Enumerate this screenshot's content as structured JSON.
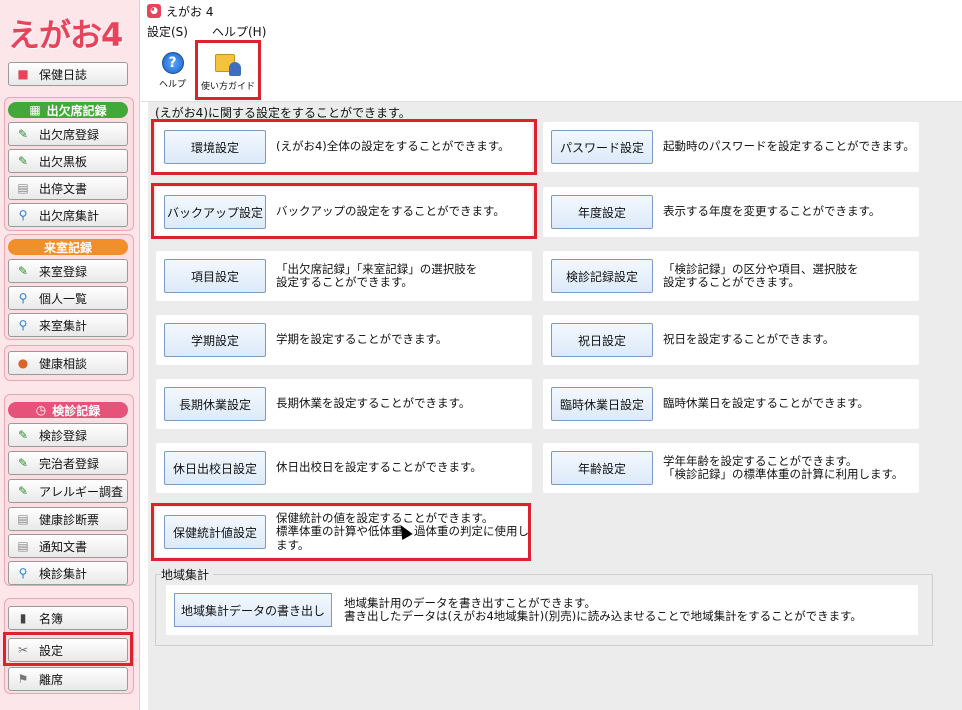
{
  "app": {
    "logo": "えがお4",
    "window_title": "えがお 4"
  },
  "menu": [
    "設定(S)",
    "ヘルプ(H)"
  ],
  "toolbar": {
    "help_label": "ヘルプ",
    "guide_label": "使い方ガイド"
  },
  "intro": "(えがお4)に関する設定をすることができます。",
  "sidebar": {
    "hoken_nisshi": "保健日誌",
    "shukketsu_head": "出欠席記録",
    "shukketsu_items": [
      "出欠席登録",
      "出欠黒板",
      "出停文書",
      "出欠席集計"
    ],
    "raishitsu_head": "来室記録",
    "raishitsu_items": [
      "来室登録",
      "個人一覧",
      "来室集計"
    ],
    "kenko_soudan": "健康相談",
    "kenshin_head": "検診記録",
    "kenshin_items": [
      "検診登録",
      "完治者登録",
      "アレルギー調査",
      "健康診断票",
      "通知文書",
      "検診集計"
    ],
    "bottom_items": [
      "名簿",
      "設定",
      "離席"
    ]
  },
  "settings": [
    {
      "button": "環境設定",
      "desc": "(えがお4)全体の設定をすることができます。"
    },
    {
      "button": "パスワード設定",
      "desc": "起動時のパスワードを設定することができます。"
    },
    {
      "button": "バックアップ設定",
      "desc": "バックアップの設定をすることができます。"
    },
    {
      "button": "年度設定",
      "desc": "表示する年度を変更することができます。"
    },
    {
      "button": "項目設定",
      "desc": "「出欠席記録」「来室記録」の選択肢を\n設定することができます。"
    },
    {
      "button": "検診記録設定",
      "desc": "「検診記録」の区分や項目、選択肢を\n設定することができます。"
    },
    {
      "button": "学期設定",
      "desc": "学期を設定することができます。"
    },
    {
      "button": "祝日設定",
      "desc": "祝日を設定することができます。"
    },
    {
      "button": "長期休業設定",
      "desc": "長期休業を設定することができます。"
    },
    {
      "button": "臨時休業日設定",
      "desc": "臨時休業日を設定することができます。"
    },
    {
      "button": "休日出校日設定",
      "desc": "休日出校日を設定することができます。"
    },
    {
      "button": "年齢設定",
      "desc": "学年年齢を設定することができます。\n「検診記録」の標準体重の計算に利用します。"
    },
    {
      "button": "保健統計値設定",
      "desc": "保健統計の値を設定することができます。\n標準体重の計算や低体重、過体重の判定に使用し\nます。"
    }
  ],
  "region": {
    "label": "地域集計",
    "button": "地域集計データの書き出し",
    "desc": "地域集計用のデータを書き出すことができます。\n書き出したデータは(えがお4地域集計)(別売)に読み込ませることで地域集計をすることができます。"
  },
  "colors": {
    "highlight_red": "#d9232d",
    "logo_pink": "#e8435a",
    "group_green": "#43a83a",
    "group_orange": "#f1902a",
    "group_pink": "#e5537a"
  }
}
